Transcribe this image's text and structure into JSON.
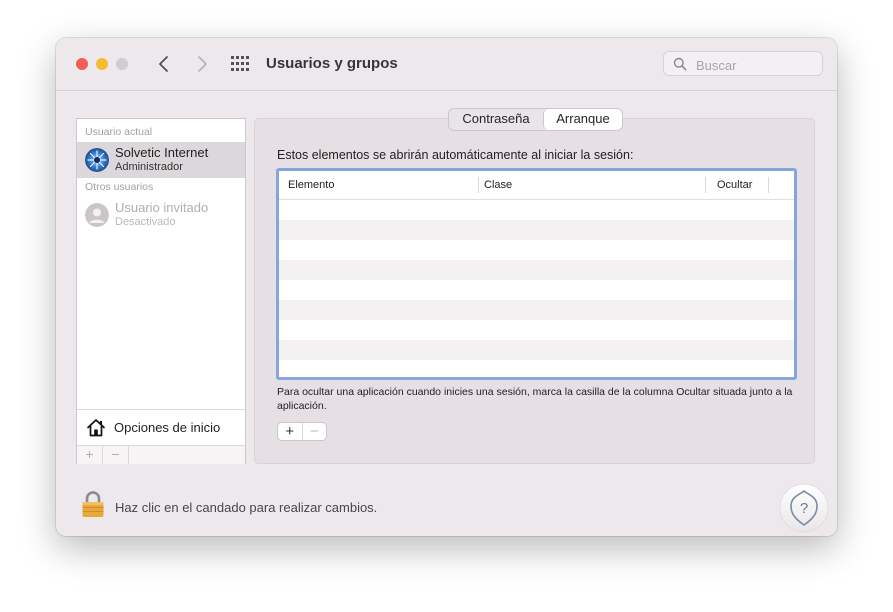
{
  "window": {
    "title": "Usuarios y grupos",
    "search_placeholder": "Buscar"
  },
  "sidebar": {
    "current_label": "Usuario actual",
    "current_user": {
      "name": "Solvetic Internet",
      "role": "Administrador"
    },
    "others_label": "Otros usuarios",
    "other_users": [
      {
        "name": "Usuario invitado",
        "role": "Desactivado"
      }
    ],
    "login_options": "Opciones de inicio",
    "add_label": "+",
    "remove_label": "−"
  },
  "tabs": [
    {
      "label": "Contraseña",
      "active": false
    },
    {
      "label": "Arranque",
      "active": true
    }
  ],
  "startup": {
    "heading": "Estos elementos se abrirán automáticamente al iniciar la sesión:",
    "columns": [
      "Elemento",
      "Clase",
      "Ocultar"
    ],
    "rows": [],
    "hint": "Para ocultar una aplicación cuando inicies una sesión, marca la casilla de la columna Ocultar situada junto a la aplicación.",
    "add_label": "+",
    "remove_label": "−"
  },
  "footer": {
    "lock_text": "Haz clic en el candado para realizar cambios."
  },
  "colors": {
    "accent": "#86a5dc",
    "close": "#ee5f57",
    "minimize": "#f5bd2e",
    "lock": "#e7a73a"
  },
  "icons": [
    "back-chevron-icon",
    "forward-chevron-icon",
    "grid-icon",
    "search-icon",
    "house-icon",
    "lock-icon",
    "help-icon"
  ]
}
